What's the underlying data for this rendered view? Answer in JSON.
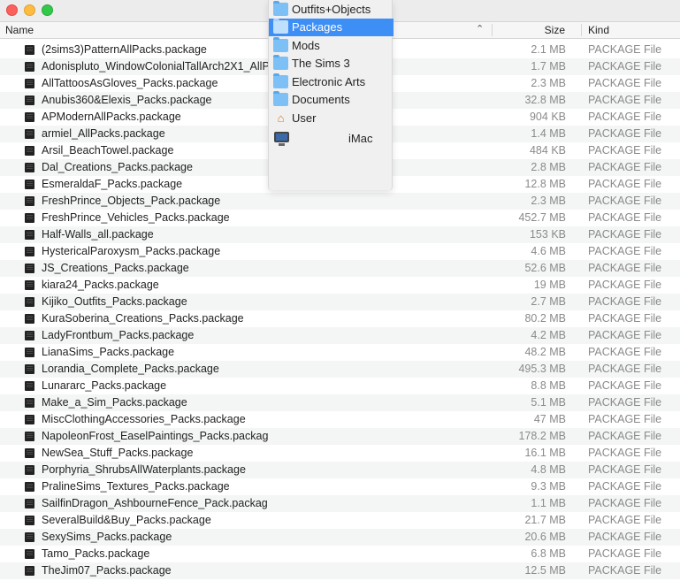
{
  "window": {
    "controls": [
      "close",
      "minimize",
      "zoom"
    ]
  },
  "columns": {
    "name": "Name",
    "size": "Size",
    "kind": "Kind"
  },
  "files": [
    {
      "name": "(2sims3)PatternAllPacks.package",
      "size": "2.1 MB",
      "kind": "PACKAGE File"
    },
    {
      "name": "Adonispluto_WindowColonialTallArch2X1_AllPacks.package",
      "size": "1.7 MB",
      "kind": "PACKAGE File"
    },
    {
      "name": "AllTattoosAsGloves_Packs.package",
      "size": "2.3 MB",
      "kind": "PACKAGE File"
    },
    {
      "name": "Anubis360&Elexis_Packs.package",
      "size": "32.8 MB",
      "kind": "PACKAGE File"
    },
    {
      "name": "APModernAllPacks.package",
      "size": "904 KB",
      "kind": "PACKAGE File"
    },
    {
      "name": "armiel_AllPacks.package",
      "size": "1.4 MB",
      "kind": "PACKAGE File"
    },
    {
      "name": "Arsil_BeachTowel.package",
      "size": "484 KB",
      "kind": "PACKAGE File"
    },
    {
      "name": "Dal_Creations_Packs.package",
      "size": "2.8 MB",
      "kind": "PACKAGE File"
    },
    {
      "name": "EsmeraldaF_Packs.package",
      "size": "12.8 MB",
      "kind": "PACKAGE File"
    },
    {
      "name": "FreshPrince_Objects_Pack.package",
      "size": "2.3 MB",
      "kind": "PACKAGE File"
    },
    {
      "name": "FreshPrince_Vehicles_Packs.package",
      "size": "452.7 MB",
      "kind": "PACKAGE File"
    },
    {
      "name": "Half-Walls_all.package",
      "size": "153 KB",
      "kind": "PACKAGE File"
    },
    {
      "name": "HystericalParoxysm_Packs.package",
      "size": "4.6 MB",
      "kind": "PACKAGE File"
    },
    {
      "name": "JS_Creations_Packs.package",
      "size": "52.6 MB",
      "kind": "PACKAGE File"
    },
    {
      "name": "kiara24_Packs.package",
      "size": "19 MB",
      "kind": "PACKAGE File"
    },
    {
      "name": "Kijiko_Outfits_Packs.package",
      "size": "2.7 MB",
      "kind": "PACKAGE File"
    },
    {
      "name": "KuraSoberina_Creations_Packs.package",
      "size": "80.2 MB",
      "kind": "PACKAGE File"
    },
    {
      "name": "LadyFrontbum_Packs.package",
      "size": "4.2 MB",
      "kind": "PACKAGE File"
    },
    {
      "name": "LianaSims_Packs.package",
      "size": "48.2 MB",
      "kind": "PACKAGE File"
    },
    {
      "name": "Lorandia_Complete_Packs.package",
      "size": "495.3 MB",
      "kind": "PACKAGE File"
    },
    {
      "name": "Lunararc_Packs.package",
      "size": "8.8 MB",
      "kind": "PACKAGE File"
    },
    {
      "name": "Make_a_Sim_Packs.package",
      "size": "5.1 MB",
      "kind": "PACKAGE File"
    },
    {
      "name": "MiscClothingAccessories_Packs.package",
      "size": "47 MB",
      "kind": "PACKAGE File"
    },
    {
      "name": "NapoleonFrost_EaselPaintings_Packs.package",
      "size": "178.2 MB",
      "kind": "PACKAGE File"
    },
    {
      "name": "NewSea_Stuff_Packs.package",
      "size": "16.1 MB",
      "kind": "PACKAGE File"
    },
    {
      "name": "Porphyria_ShrubsAllWaterplants.package",
      "size": "4.8 MB",
      "kind": "PACKAGE File"
    },
    {
      "name": "PralineSims_Textures_Packs.package",
      "size": "9.3 MB",
      "kind": "PACKAGE File"
    },
    {
      "name": "SailfinDragon_AshbourneFence_Pack.package",
      "size": "1.1 MB",
      "kind": "PACKAGE File"
    },
    {
      "name": "SeveralBuild&Buy_Packs.package",
      "size": "21.7 MB",
      "kind": "PACKAGE File"
    },
    {
      "name": "SexySims_Packs.package",
      "size": "20.6 MB",
      "kind": "PACKAGE File"
    },
    {
      "name": "Tamo_Packs.package",
      "size": "6.8 MB",
      "kind": "PACKAGE File"
    },
    {
      "name": "TheJim07_Packs.package",
      "size": "12.5 MB",
      "kind": "PACKAGE File"
    }
  ],
  "path_menu": {
    "items": [
      {
        "label": "Outfits+Objects",
        "icon": "folder-icon"
      },
      {
        "label": "Packages",
        "icon": "folder-icon",
        "selected": true
      },
      {
        "label": "Mods",
        "icon": "folder-icon"
      },
      {
        "label": "The Sims 3",
        "icon": "folder-icon"
      },
      {
        "label": "Electronic Arts",
        "icon": "folder-icon"
      },
      {
        "label": "Documents",
        "icon": "documents-folder-icon"
      },
      {
        "label": "User",
        "icon": "home-icon"
      },
      {
        "label": "iMac",
        "icon": "imac-icon"
      }
    ],
    "selected_color": "#3d8ef5"
  }
}
